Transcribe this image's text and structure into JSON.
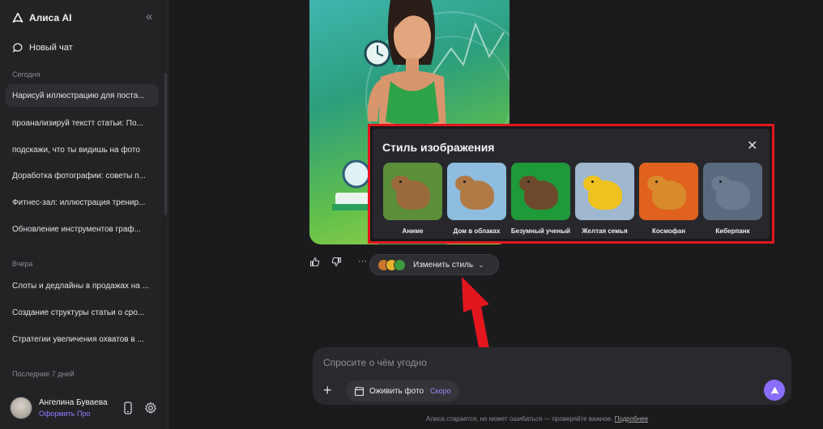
{
  "sidebar": {
    "brand": "Алиса AI",
    "new_chat": "Новый чат",
    "sections": [
      {
        "title": "Сегодня",
        "items": [
          "Нарисуй иллюстрацию для поста...",
          "проанализируй текстт статьи: По...",
          "подскажи, что ты видишь на фото",
          "Доработка фотографии: советы п...",
          "Фитнес-зал: иллюстрация тренир...",
          "Обновление инструментов граф..."
        ]
      },
      {
        "title": "Вчера",
        "items": [
          "Слоты и дедлайны в продажах на ...",
          "Создание структуры статьи о сро...",
          "Стратегии увеличения охватов в ..."
        ]
      },
      {
        "title": "Последние 7 дней",
        "items": []
      }
    ],
    "user": {
      "name": "Ангелина Буваева",
      "plan": "Оформить Про"
    }
  },
  "message": {
    "change_style_label": "Изменить стиль"
  },
  "style_popup": {
    "title": "Стиль изображения",
    "styles": [
      {
        "label": "Аниме",
        "bg": "#5b8f3a",
        "body": "#9a6a3c"
      },
      {
        "label": "Дом в облаках",
        "bg": "#8fbde0",
        "body": "#b07a45"
      },
      {
        "label": "Безумный ученый",
        "bg": "#1f9a3a",
        "body": "#6e4a2c"
      },
      {
        "label": "Желтая семья",
        "bg": "#9fb7cf",
        "body": "#f0c21e"
      },
      {
        "label": "Космофан",
        "bg": "#e0621e",
        "body": "#d88a2c"
      },
      {
        "label": "Киберпанк",
        "bg": "#5a6a7e",
        "body": "#6b7a8e"
      }
    ]
  },
  "composer": {
    "placeholder": "Спросите о чём угодно",
    "revive_label": "Оживить фото",
    "soon_badge": "Скоро"
  },
  "footer": {
    "disclaimer": "Алиса старается, но может ошибаться — проверяйте важное.",
    "more_link": "Подробнее"
  },
  "colors": {
    "accent": "#8a6cff",
    "highlight": "#e3161e"
  }
}
